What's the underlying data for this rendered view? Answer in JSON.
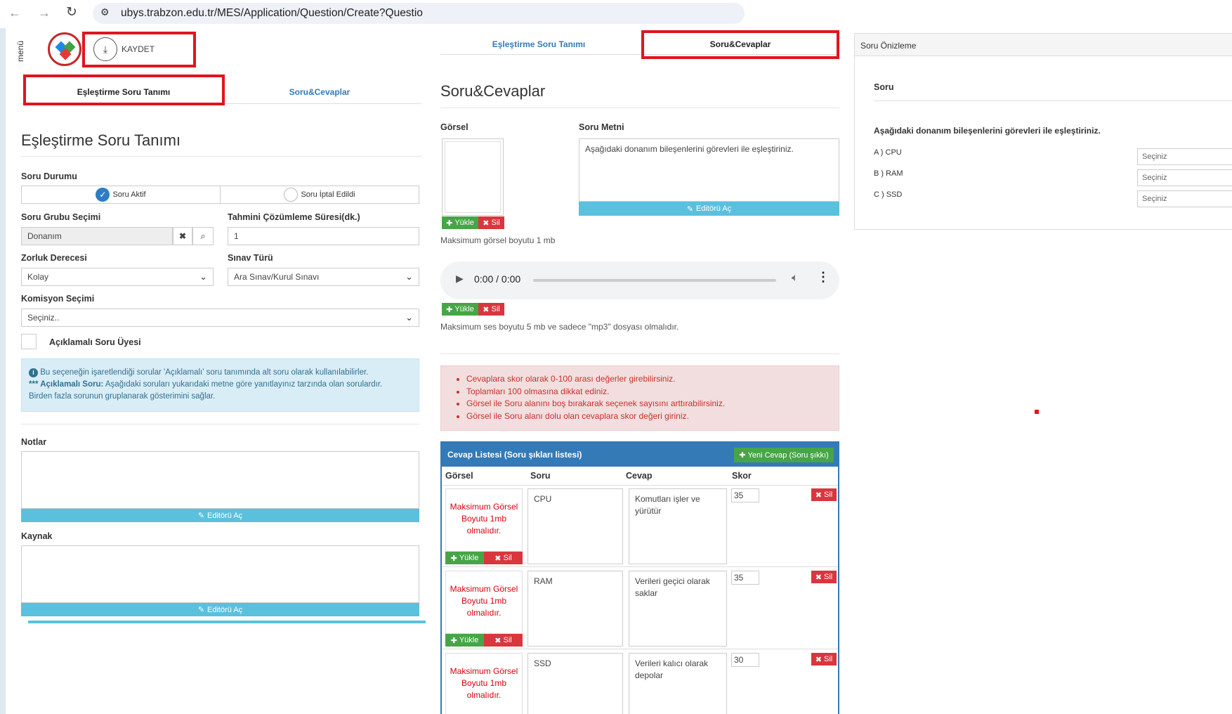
{
  "browser": {
    "url": "ubys.trabzon.edu.tr/MES/Application/Question/Create?Questio"
  },
  "topbar": {
    "menu_label": "menü",
    "save_label": "KAYDET"
  },
  "left": {
    "tabs": [
      "Eşleştirme Soru Tanımı",
      "Soru&Cevaplar"
    ],
    "title": "Eşleştirme Soru Tanımı",
    "soru_durumu_label": "Soru Durumu",
    "status_options": [
      "Soru Aktif",
      "Soru İptal Edildi"
    ],
    "soru_grubu_label": "Soru Grubu Seçimi",
    "soru_grubu_value": "Donanım",
    "tahmini_label": "Tahmini Çözümleme Süresi(dk.)",
    "tahmini_value": "1",
    "zorluk_label": "Zorluk Derecesi",
    "zorluk_value": "Kolay",
    "sinav_label": "Sınav Türü",
    "sinav_value": "Ara Sınav/Kurul Sınavı",
    "komisyon_label": "Komisyon Seçimi",
    "komisyon_value": "Seçiniz..",
    "aciklamali_label": "Açıklamalı Soru Üyesi",
    "info_line1": "Bu seçeneğin işaretlendiği sorular 'Açıklamalı' soru tanımında alt soru olarak kullanılabilirler.",
    "info_line2_prefix": "*** Açıklamalı Soru:",
    "info_line2_rest": " Aşağıdaki soruları yukarıdaki metne göre yanıtlayınız tarzında olan sorulardır.",
    "info_line3": "Birden fazla sorunun gruplanarak gösterimini sağlar.",
    "notlar_label": "Notlar",
    "kaynak_label": "Kaynak",
    "editor_label": "Editörü Aç"
  },
  "middle": {
    "tabs": [
      "Eşleştirme Soru Tanımı",
      "Soru&Cevaplar"
    ],
    "title": "Soru&Cevaplar",
    "gorsel_label": "Görsel",
    "soru_metni_label": "Soru Metni",
    "soru_metni_value": "Aşağıdaki donanım bileşenlerini görevleri ile eşleştiriniz.",
    "editor_label": "Editörü Aç",
    "yukle_label": "Yükle",
    "sil_label": "Sil",
    "max_gorsel_note": "Maksimum görsel boyutu 1 mb",
    "audio_time": "0:00 / 0:00",
    "max_ses_note": "Maksimum ses boyutu 5 mb ve sadece \"mp3\" dosyası olmalıdır.",
    "warnings": [
      "Cevaplara skor olarak 0-100 arası değerler girebilirsiniz.",
      "Toplamları 100 olmasına dikkat ediniz.",
      "Görsel ile Soru alanını boş bırakarak seçenek sayısını arttırabilirsiniz.",
      "Görsel ile Soru alanı dolu olan cevaplara skor değeri giriniz."
    ],
    "cevap_listesi_title": "Cevap Listesi (Soru şıkları listesi)",
    "yeni_cevap_label": "Yeni Cevap (Soru şıkkı)",
    "columns": [
      "Görsel",
      "Soru",
      "Cevap",
      "Skor"
    ],
    "max_gorsel_cell": [
      "Maksimum Görsel",
      "Boyutu 1mb",
      "olmalıdır."
    ],
    "rows": [
      {
        "soru": "CPU",
        "cevap": "Komutları işler ve yürütür",
        "skor": "35"
      },
      {
        "soru": "RAM",
        "cevap": "Verileri geçici olarak saklar",
        "skor": "35"
      },
      {
        "soru": "SSD",
        "cevap": "Verileri kalıcı olarak depolar",
        "skor": "30"
      }
    ]
  },
  "preview": {
    "header": "Soru Önizleme",
    "soru_label": "Soru",
    "question_text": "Aşağıdaki donanım bileşenlerini görevleri ile eşleştiriniz.",
    "options": [
      {
        "label": "A ) CPU",
        "select": "Seçiniz"
      },
      {
        "label": "B ) RAM",
        "select": "Seçiniz"
      },
      {
        "label": "C ) SSD",
        "select": "Seçiniz"
      }
    ]
  },
  "colors": {
    "red_highlight": "#e0151e",
    "link_blue": "#337ab7",
    "info_bg": "#d9edf7",
    "editor_bar": "#5bc0de",
    "green_btn": "#46a546",
    "red_btn": "#d9363e",
    "panel_header": "#337ab7"
  }
}
